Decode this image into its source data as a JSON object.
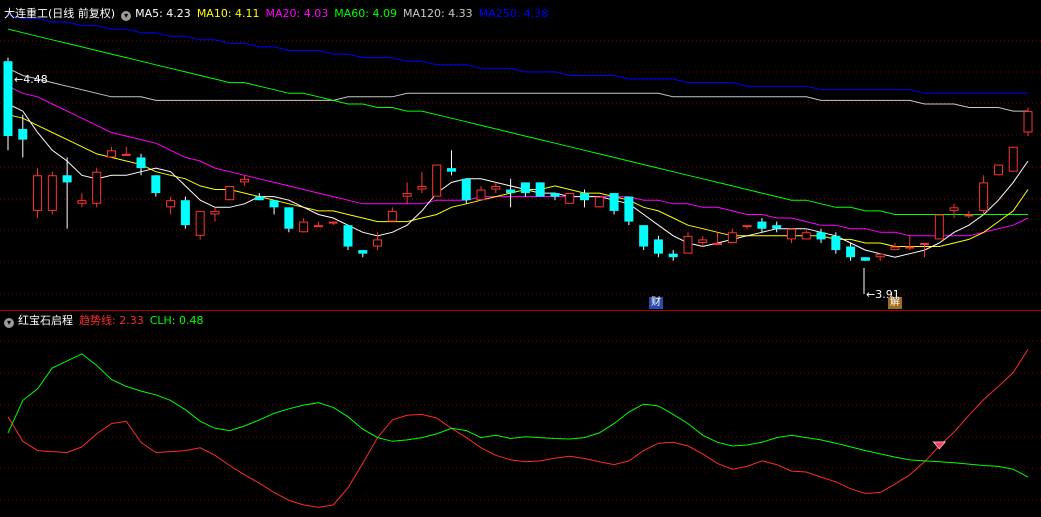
{
  "main_panel": {
    "title": "大连重工(日线 前复权)",
    "indicators": [
      {
        "label": "MA5: 4.23",
        "color": "#ffffff"
      },
      {
        "label": "MA10: 4.11",
        "color": "#ffff00"
      },
      {
        "label": "MA20: 4.03",
        "color": "#ff00ff"
      },
      {
        "label": "MA60: 4.09",
        "color": "#00ff00"
      },
      {
        "label": "MA120: 4.33",
        "color": "#c8c8c8"
      },
      {
        "label": "MA250: 4.38",
        "color": "#0000ff"
      }
    ],
    "high_marker": "4.48",
    "low_marker": "3.91",
    "badge_cai": "财",
    "badge_jie": "解"
  },
  "sub_panel": {
    "title": "红宝石启程",
    "indicators": [
      {
        "label": "趋势线: 2.33",
        "color": "#ff2a2a"
      },
      {
        "label": "CLH: 0.48",
        "color": "#00ff00"
      }
    ]
  },
  "colors": {
    "up": "#ff3232",
    "down": "#00ffff",
    "grid": "#7a0000",
    "panel_border": "#b00000"
  },
  "chart_data": [
    {
      "type": "candlestick",
      "title": "大连重工(日线 前复权)",
      "ylim": [
        3.8,
        4.58
      ],
      "candles": [
        {
          "o": 4.47,
          "h": 4.48,
          "l": 4.22,
          "c": 4.26
        },
        {
          "o": 4.28,
          "h": 4.32,
          "l": 4.2,
          "c": 4.25
        },
        {
          "o": 4.05,
          "h": 4.17,
          "l": 4.03,
          "c": 4.15
        },
        {
          "o": 4.05,
          "h": 4.16,
          "l": 4.04,
          "c": 4.15
        },
        {
          "o": 4.15,
          "h": 4.2,
          "l": 4.0,
          "c": 4.13
        },
        {
          "o": 4.07,
          "h": 4.1,
          "l": 4.06,
          "c": 4.08
        },
        {
          "o": 4.07,
          "h": 4.17,
          "l": 4.06,
          "c": 4.16
        },
        {
          "o": 4.2,
          "h": 4.23,
          "l": 4.2,
          "c": 4.22
        },
        {
          "o": 4.21,
          "h": 4.23,
          "l": 4.21,
          "c": 4.21
        },
        {
          "o": 4.2,
          "h": 4.21,
          "l": 4.15,
          "c": 4.17
        },
        {
          "o": 4.15,
          "h": 4.15,
          "l": 4.09,
          "c": 4.1
        },
        {
          "o": 4.06,
          "h": 4.09,
          "l": 4.04,
          "c": 4.08
        },
        {
          "o": 4.08,
          "h": 4.09,
          "l": 4.0,
          "c": 4.01
        },
        {
          "o": 3.98,
          "h": 4.05,
          "l": 3.97,
          "c": 4.05
        },
        {
          "o": 4.04,
          "h": 4.06,
          "l": 4.02,
          "c": 4.05
        },
        {
          "o": 4.08,
          "h": 4.12,
          "l": 4.08,
          "c": 4.12
        },
        {
          "o": 4.13,
          "h": 4.15,
          "l": 4.12,
          "c": 4.14
        },
        {
          "o": 4.09,
          "h": 4.1,
          "l": 4.08,
          "c": 4.08
        },
        {
          "o": 4.08,
          "h": 4.08,
          "l": 4.04,
          "c": 4.06
        },
        {
          "o": 4.06,
          "h": 4.06,
          "l": 3.99,
          "c": 4.0
        },
        {
          "o": 3.99,
          "h": 4.03,
          "l": 3.99,
          "c": 4.02
        },
        {
          "o": 4.01,
          "h": 4.02,
          "l": 4.01,
          "c": 4.01
        },
        {
          "o": 4.02,
          "h": 4.02,
          "l": 4.01,
          "c": 4.02
        },
        {
          "o": 4.01,
          "h": 4.01,
          "l": 3.94,
          "c": 3.95
        },
        {
          "o": 3.94,
          "h": 3.94,
          "l": 3.92,
          "c": 3.93
        },
        {
          "o": 3.95,
          "h": 3.99,
          "l": 3.94,
          "c": 3.97
        },
        {
          "o": 4.02,
          "h": 4.06,
          "l": 4.02,
          "c": 4.05
        },
        {
          "o": 4.09,
          "h": 4.13,
          "l": 4.07,
          "c": 4.1
        },
        {
          "o": 4.11,
          "h": 4.16,
          "l": 4.1,
          "c": 4.12
        },
        {
          "o": 4.09,
          "h": 4.18,
          "l": 4.09,
          "c": 4.18
        },
        {
          "o": 4.17,
          "h": 4.22,
          "l": 4.15,
          "c": 4.16
        },
        {
          "o": 4.14,
          "h": 4.14,
          "l": 4.07,
          "c": 4.08
        },
        {
          "o": 4.08,
          "h": 4.12,
          "l": 4.08,
          "c": 4.11
        },
        {
          "o": 4.11,
          "h": 4.13,
          "l": 4.1,
          "c": 4.12
        },
        {
          "o": 4.11,
          "h": 4.14,
          "l": 4.06,
          "c": 4.1
        },
        {
          "o": 4.13,
          "h": 4.13,
          "l": 4.09,
          "c": 4.1
        },
        {
          "o": 4.13,
          "h": 4.13,
          "l": 4.09,
          "c": 4.09
        },
        {
          "o": 4.1,
          "h": 4.1,
          "l": 4.08,
          "c": 4.09
        },
        {
          "o": 4.07,
          "h": 4.1,
          "l": 4.07,
          "c": 4.1
        },
        {
          "o": 4.1,
          "h": 4.11,
          "l": 4.06,
          "c": 4.08
        },
        {
          "o": 4.06,
          "h": 4.09,
          "l": 4.06,
          "c": 4.09
        },
        {
          "o": 4.1,
          "h": 4.1,
          "l": 4.04,
          "c": 4.05
        },
        {
          "o": 4.09,
          "h": 4.09,
          "l": 4.01,
          "c": 4.02
        },
        {
          "o": 4.01,
          "h": 4.01,
          "l": 3.94,
          "c": 3.95
        },
        {
          "o": 3.97,
          "h": 3.98,
          "l": 3.92,
          "c": 3.93
        },
        {
          "o": 3.93,
          "h": 3.94,
          "l": 3.91,
          "c": 3.92
        },
        {
          "o": 3.93,
          "h": 3.99,
          "l": 3.93,
          "c": 3.98
        },
        {
          "o": 3.96,
          "h": 3.98,
          "l": 3.95,
          "c": 3.97
        },
        {
          "o": 3.96,
          "h": 3.99,
          "l": 3.96,
          "c": 3.96
        },
        {
          "o": 3.96,
          "h": 4.0,
          "l": 3.96,
          "c": 3.99
        },
        {
          "o": 4.01,
          "h": 4.01,
          "l": 4.0,
          "c": 4.01
        },
        {
          "o": 4.02,
          "h": 4.03,
          "l": 3.99,
          "c": 4.0
        },
        {
          "o": 4.01,
          "h": 4.02,
          "l": 3.99,
          "c": 4.0
        },
        {
          "o": 3.97,
          "h": 4.0,
          "l": 3.96,
          "c": 4.0
        },
        {
          "o": 3.97,
          "h": 4.0,
          "l": 3.97,
          "c": 3.99
        },
        {
          "o": 3.99,
          "h": 4.0,
          "l": 3.96,
          "c": 3.97
        },
        {
          "o": 3.98,
          "h": 3.99,
          "l": 3.93,
          "c": 3.94
        },
        {
          "o": 3.95,
          "h": 3.96,
          "l": 3.91,
          "c": 3.92
        },
        {
          "o": 3.92,
          "h": 3.92,
          "l": 3.91,
          "c": 3.91
        },
        {
          "o": 3.92,
          "h": 3.93,
          "l": 3.91,
          "c": 3.93
        },
        {
          "o": 3.94,
          "h": 3.96,
          "l": 3.94,
          "c": 3.95
        },
        {
          "o": 3.95,
          "h": 3.98,
          "l": 3.94,
          "c": 3.95
        },
        {
          "o": 3.96,
          "h": 3.96,
          "l": 3.92,
          "c": 3.96
        },
        {
          "o": 3.97,
          "h": 4.04,
          "l": 3.97,
          "c": 4.04
        },
        {
          "o": 4.05,
          "h": 4.07,
          "l": 4.03,
          "c": 4.06
        },
        {
          "o": 4.04,
          "h": 4.05,
          "l": 4.03,
          "c": 4.04
        },
        {
          "o": 4.05,
          "h": 4.15,
          "l": 4.04,
          "c": 4.13
        },
        {
          "o": 4.15,
          "h": 4.18,
          "l": 4.15,
          "c": 4.18
        },
        {
          "o": 4.16,
          "h": 4.23,
          "l": 4.16,
          "c": 4.23
        },
        {
          "o": 4.27,
          "h": 4.34,
          "l": 4.26,
          "c": 4.33
        }
      ],
      "ma": {
        "MA5": [
          4.35,
          4.33,
          4.27,
          4.22,
          4.19,
          4.15,
          4.14,
          4.15,
          4.15,
          4.16,
          4.17,
          4.16,
          4.12,
          4.08,
          4.06,
          4.06,
          4.07,
          4.09,
          4.09,
          4.08,
          4.06,
          4.04,
          4.03,
          4.01,
          3.99,
          3.98,
          3.99,
          4.01,
          4.05,
          4.1,
          4.13,
          4.14,
          4.14,
          4.13,
          4.12,
          4.11,
          4.1,
          4.1,
          4.09,
          4.09,
          4.09,
          4.08,
          4.07,
          4.04,
          4.01,
          3.98,
          3.96,
          3.95,
          3.96,
          3.97,
          3.98,
          3.99,
          4.0,
          4.0,
          4.0,
          3.99,
          3.98,
          3.96,
          3.94,
          3.93,
          3.92,
          3.93,
          3.94,
          3.96,
          3.99,
          4.01,
          4.04,
          4.08,
          4.13,
          4.19
        ],
        "MA10": [
          4.32,
          4.31,
          4.29,
          4.27,
          4.25,
          4.23,
          4.21,
          4.2,
          4.19,
          4.18,
          4.16,
          4.15,
          4.14,
          4.12,
          4.11,
          4.11,
          4.1,
          4.09,
          4.08,
          4.07,
          4.06,
          4.05,
          4.05,
          4.04,
          4.03,
          4.02,
          4.02,
          4.02,
          4.03,
          4.04,
          4.06,
          4.07,
          4.08,
          4.09,
          4.1,
          4.11,
          4.11,
          4.12,
          4.11,
          4.1,
          4.1,
          4.09,
          4.08,
          4.06,
          4.05,
          4.03,
          4.01,
          4.0,
          3.99,
          3.98,
          3.98,
          3.98,
          3.98,
          3.98,
          3.98,
          3.98,
          3.97,
          3.97,
          3.96,
          3.96,
          3.95,
          3.95,
          3.95,
          3.95,
          3.96,
          3.97,
          3.99,
          4.02,
          4.05,
          4.11
        ],
        "MA20": [
          4.4,
          4.38,
          4.37,
          4.35,
          4.33,
          4.31,
          4.29,
          4.27,
          4.26,
          4.25,
          4.24,
          4.22,
          4.2,
          4.19,
          4.17,
          4.16,
          4.15,
          4.14,
          4.13,
          4.12,
          4.11,
          4.1,
          4.09,
          4.08,
          4.07,
          4.07,
          4.07,
          4.07,
          4.07,
          4.08,
          4.08,
          4.08,
          4.09,
          4.09,
          4.09,
          4.09,
          4.09,
          4.09,
          4.09,
          4.09,
          4.09,
          4.09,
          4.09,
          4.08,
          4.08,
          4.07,
          4.07,
          4.06,
          4.06,
          4.05,
          4.04,
          4.04,
          4.03,
          4.03,
          4.02,
          4.01,
          4.01,
          4.0,
          4.0,
          3.99,
          3.99,
          3.98,
          3.98,
          3.98,
          3.98,
          3.98,
          3.99,
          4.0,
          4.01,
          4.03
        ],
        "MA60": [
          4.56,
          4.55,
          4.54,
          4.53,
          4.52,
          4.51,
          4.5,
          4.49,
          4.48,
          4.47,
          4.46,
          4.45,
          4.44,
          4.43,
          4.42,
          4.41,
          4.41,
          4.4,
          4.39,
          4.38,
          4.38,
          4.37,
          4.36,
          4.35,
          4.35,
          4.34,
          4.34,
          4.33,
          4.33,
          4.32,
          4.31,
          4.3,
          4.29,
          4.28,
          4.27,
          4.26,
          4.25,
          4.24,
          4.23,
          4.22,
          4.21,
          4.2,
          4.19,
          4.18,
          4.17,
          4.16,
          4.15,
          4.14,
          4.13,
          4.12,
          4.11,
          4.1,
          4.09,
          4.08,
          4.08,
          4.07,
          4.06,
          4.06,
          4.05,
          4.05,
          4.04,
          4.04,
          4.04,
          4.04,
          4.04,
          4.04,
          4.04,
          4.04,
          4.04,
          4.04
        ],
        "MA120": [
          4.45,
          4.43,
          4.42,
          4.41,
          4.4,
          4.39,
          4.38,
          4.37,
          4.37,
          4.37,
          4.36,
          4.36,
          4.36,
          4.36,
          4.36,
          4.36,
          4.36,
          4.36,
          4.36,
          4.36,
          4.36,
          4.36,
          4.36,
          4.37,
          4.37,
          4.37,
          4.37,
          4.38,
          4.38,
          4.38,
          4.38,
          4.38,
          4.38,
          4.38,
          4.38,
          4.38,
          4.38,
          4.38,
          4.38,
          4.38,
          4.38,
          4.38,
          4.38,
          4.38,
          4.38,
          4.37,
          4.37,
          4.37,
          4.37,
          4.37,
          4.37,
          4.37,
          4.37,
          4.37,
          4.37,
          4.36,
          4.36,
          4.36,
          4.36,
          4.36,
          4.36,
          4.36,
          4.35,
          4.35,
          4.35,
          4.34,
          4.34,
          4.34,
          4.33,
          4.33
        ],
        "MA250": [
          4.6,
          4.59,
          4.59,
          4.58,
          4.58,
          4.57,
          4.57,
          4.56,
          4.56,
          4.55,
          4.55,
          4.54,
          4.54,
          4.53,
          4.53,
          4.52,
          4.52,
          4.51,
          4.51,
          4.5,
          4.5,
          4.5,
          4.49,
          4.49,
          4.48,
          4.48,
          4.48,
          4.47,
          4.47,
          4.46,
          4.46,
          4.46,
          4.45,
          4.45,
          4.45,
          4.44,
          4.44,
          4.44,
          4.43,
          4.43,
          4.43,
          4.43,
          4.42,
          4.42,
          4.42,
          4.42,
          4.41,
          4.41,
          4.41,
          4.41,
          4.4,
          4.4,
          4.4,
          4.4,
          4.4,
          4.39,
          4.39,
          4.39,
          4.39,
          4.39,
          4.39,
          4.39,
          4.38,
          4.38,
          4.38,
          4.38,
          4.38,
          4.38,
          4.38,
          4.38
        ]
      }
    },
    {
      "type": "line",
      "title": "红宝石启程",
      "ylim": [
        -0.7,
        3.3
      ],
      "series": [
        {
          "name": "趋势线",
          "color": "#ff2a2a",
          "values": [
            1.35,
            0.82,
            0.62,
            0.6,
            0.58,
            0.7,
            0.98,
            1.2,
            1.25,
            0.8,
            0.58,
            0.6,
            0.62,
            0.68,
            0.52,
            0.3,
            0.1,
            -0.08,
            -0.28,
            -0.45,
            -0.55,
            -0.6,
            -0.55,
            -0.18,
            0.35,
            0.9,
            1.28,
            1.38,
            1.4,
            1.32,
            1.1,
            0.9,
            0.68,
            0.52,
            0.42,
            0.38,
            0.4,
            0.46,
            0.5,
            0.45,
            0.38,
            0.32,
            0.4,
            0.62,
            0.78,
            0.8,
            0.72,
            0.55,
            0.34,
            0.22,
            0.28,
            0.4,
            0.32,
            0.18,
            0.16,
            0.05,
            -0.05,
            -0.2,
            -0.3,
            -0.28,
            -0.1,
            0.1,
            0.38,
            0.72,
            1.02,
            1.38,
            1.72,
            2.0,
            2.3,
            2.8
          ]
        },
        {
          "name": "CLH",
          "color": "#00ff00",
          "values": [
            1.0,
            1.7,
            1.95,
            2.4,
            2.55,
            2.7,
            2.45,
            2.15,
            2.0,
            1.9,
            1.82,
            1.7,
            1.5,
            1.25,
            1.1,
            1.05,
            1.15,
            1.28,
            1.42,
            1.52,
            1.6,
            1.65,
            1.55,
            1.35,
            1.08,
            0.9,
            0.82,
            0.85,
            0.9,
            0.98,
            1.1,
            1.05,
            0.9,
            0.95,
            0.88,
            0.92,
            0.9,
            0.88,
            0.87,
            0.9,
            1.0,
            1.2,
            1.45,
            1.62,
            1.58,
            1.4,
            1.2,
            0.95,
            0.8,
            0.72,
            0.74,
            0.8,
            0.9,
            0.95,
            0.9,
            0.85,
            0.78,
            0.7,
            0.62,
            0.55,
            0.48,
            0.42,
            0.4,
            0.38,
            0.36,
            0.33,
            0.3,
            0.28,
            0.22,
            0.05
          ]
        }
      ]
    }
  ]
}
